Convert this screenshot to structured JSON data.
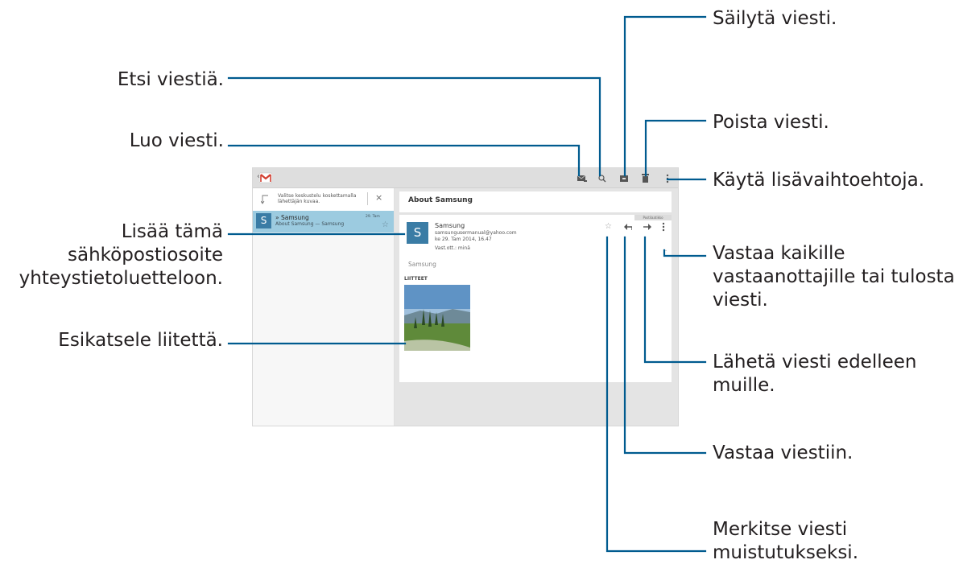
{
  "callouts": {
    "keep": "Säilytä viesti.",
    "search": "Etsi viestiä.",
    "delete": "Poista viesti.",
    "compose": "Luo viesti.",
    "more_options": "Käytä lisävaihtoehtoja.",
    "add_contact": [
      "Lisää tämä",
      "sähköpostiosoite",
      "yhteystietoluetteloon."
    ],
    "reply_all": [
      "Vastaa kaikille",
      "vastaanottajille tai tulosta",
      "viesti."
    ],
    "preview": "Esikatsele liitettä.",
    "forward": [
      "Lähetä viesti edelleen",
      "muille."
    ],
    "reply": "Vastaa viestiin.",
    "star": [
      "Merkitse viesti",
      "muistutukseksi."
    ]
  },
  "app": {
    "hint_text": [
      "Valitse keskustelu koskettamalla",
      "lähettäjän kuvaa."
    ],
    "list_item": {
      "avatar_letter": "S",
      "sender": "Samsung",
      "subject_preview": "About Samsung — Samsung",
      "date": "29. Tam"
    },
    "subject": "About Samsung",
    "folder_chip": "Postilaatikko",
    "message": {
      "avatar_letter": "S",
      "sender": "Samsung",
      "email": "samsungusermanual@yahoo.com",
      "datetime": "ke 29. Tam 2014, 16.47",
      "to": "Vast.ott.: minä",
      "body": "Samsung",
      "attachments_label": "LIITTEET"
    }
  },
  "colors": {
    "line": "#005b8f",
    "accent_blue": "#3a7ca5",
    "selected_row": "#9ccbe0",
    "gmail_red": "#d23f31"
  },
  "icons": {
    "compose": "compose-icon",
    "search": "search-icon",
    "archive": "archive-icon",
    "delete": "trash-icon",
    "overflow": "overflow-menu-icon",
    "star": "star-icon",
    "reply": "reply-icon",
    "forward": "forward-icon"
  }
}
